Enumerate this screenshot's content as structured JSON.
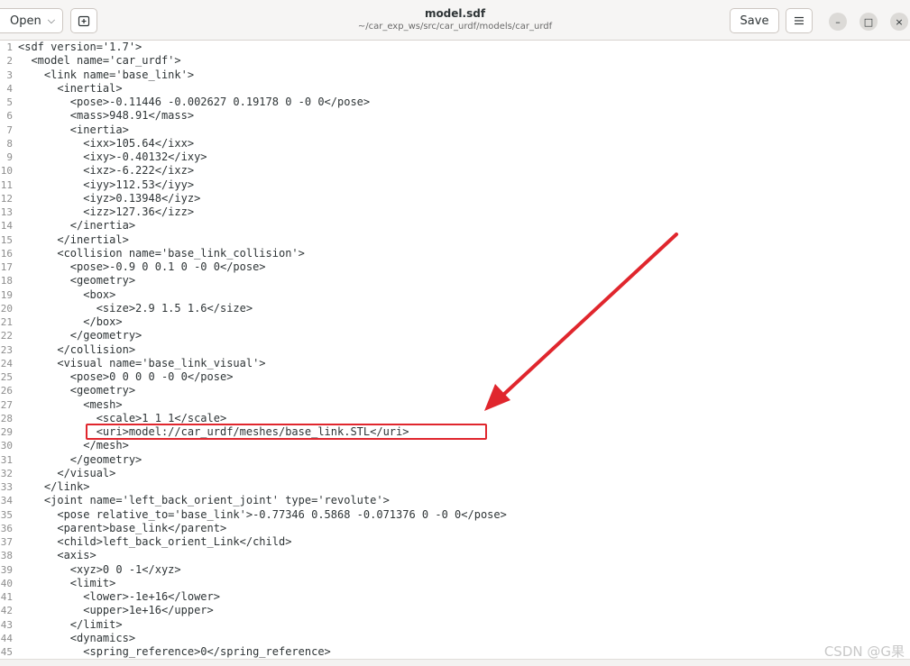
{
  "window": {
    "title": "model.sdf",
    "path": "~/car_exp_ws/src/car_urdf/models/car_urdf"
  },
  "headerbar": {
    "open_label": "Open",
    "open_chevron_icon": "chevron-down-icon",
    "new_tab_icon": "new-tab-icon",
    "save_label": "Save",
    "menu_icon": "hamburger-menu-icon",
    "minimize_glyph": "–",
    "maximize_glyph": "□",
    "close_glyph": "×"
  },
  "editor": {
    "lines": [
      {
        "num": "1",
        "text": "<sdf version='1.7'>"
      },
      {
        "num": "2",
        "text": "  <model name='car_urdf'>"
      },
      {
        "num": "3",
        "text": "    <link name='base_link'>"
      },
      {
        "num": "4",
        "text": "      <inertial>"
      },
      {
        "num": "5",
        "text": "        <pose>-0.11446 -0.002627 0.19178 0 -0 0</pose>"
      },
      {
        "num": "6",
        "text": "        <mass>948.91</mass>"
      },
      {
        "num": "7",
        "text": "        <inertia>"
      },
      {
        "num": "8",
        "text": "          <ixx>105.64</ixx>"
      },
      {
        "num": "9",
        "text": "          <ixy>-0.40132</ixy>"
      },
      {
        "num": "10",
        "text": "          <ixz>-6.222</ixz>"
      },
      {
        "num": "11",
        "text": "          <iyy>112.53</iyy>"
      },
      {
        "num": "12",
        "text": "          <iyz>0.13948</iyz>"
      },
      {
        "num": "13",
        "text": "          <izz>127.36</izz>"
      },
      {
        "num": "14",
        "text": "        </inertia>"
      },
      {
        "num": "15",
        "text": "      </inertial>"
      },
      {
        "num": "16",
        "text": "      <collision name='base_link_collision'>"
      },
      {
        "num": "17",
        "text": "        <pose>-0.9 0 0.1 0 -0 0</pose>"
      },
      {
        "num": "18",
        "text": "        <geometry>"
      },
      {
        "num": "19",
        "text": "          <box>"
      },
      {
        "num": "20",
        "text": "            <size>2.9 1.5 1.6</size>"
      },
      {
        "num": "21",
        "text": "          </box>"
      },
      {
        "num": "22",
        "text": "        </geometry>"
      },
      {
        "num": "23",
        "text": "      </collision>"
      },
      {
        "num": "24",
        "text": "      <visual name='base_link_visual'>"
      },
      {
        "num": "25",
        "text": "        <pose>0 0 0 0 -0 0</pose>"
      },
      {
        "num": "26",
        "text": "        <geometry>"
      },
      {
        "num": "27",
        "text": "          <mesh>"
      },
      {
        "num": "28",
        "text": "            <scale>1 1 1</scale>"
      },
      {
        "num": "29",
        "text": "            <uri>model://car_urdf/meshes/base_link.STL</uri>"
      },
      {
        "num": "30",
        "text": "          </mesh>"
      },
      {
        "num": "31",
        "text": "        </geometry>"
      },
      {
        "num": "32",
        "text": "      </visual>"
      },
      {
        "num": "33",
        "text": "    </link>"
      },
      {
        "num": "34",
        "text": "    <joint name='left_back_orient_joint' type='revolute'>"
      },
      {
        "num": "35",
        "text": "      <pose relative_to='base_link'>-0.77346 0.5868 -0.071376 0 -0 0</pose>"
      },
      {
        "num": "36",
        "text": "      <parent>base_link</parent>"
      },
      {
        "num": "37",
        "text": "      <child>left_back_orient_Link</child>"
      },
      {
        "num": "38",
        "text": "      <axis>"
      },
      {
        "num": "39",
        "text": "        <xyz>0 0 -1</xyz>"
      },
      {
        "num": "40",
        "text": "        <limit>"
      },
      {
        "num": "41",
        "text": "          <lower>-1e+16</lower>"
      },
      {
        "num": "42",
        "text": "          <upper>1e+16</upper>"
      },
      {
        "num": "43",
        "text": "        </limit>"
      },
      {
        "num": "44",
        "text": "        <dynamics>"
      },
      {
        "num": "45",
        "text": "          <spring_reference>0</spring_reference>"
      }
    ]
  },
  "annotation": {
    "highlight_color": "#e0262d",
    "highlighted_line": 29,
    "arrow_color": "#e0262d"
  },
  "watermark": "CSDN @G果"
}
